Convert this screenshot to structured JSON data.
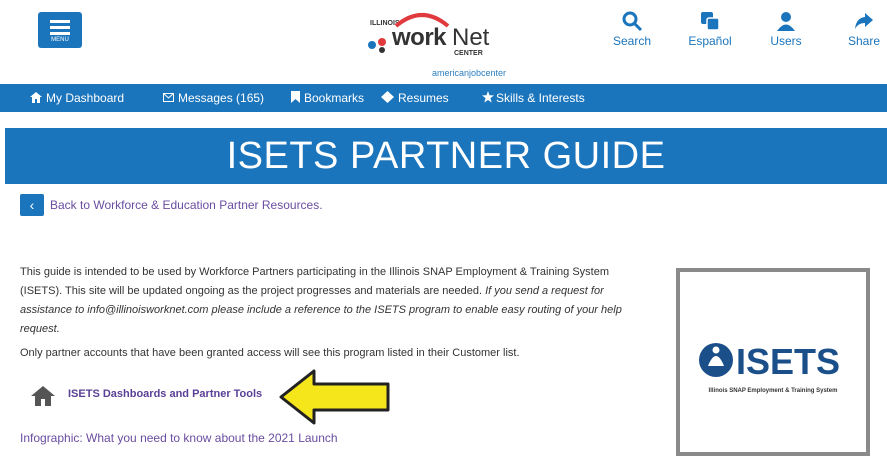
{
  "header": {
    "menu_label": "MENU",
    "logo": {
      "illinois": "ILLINOIS",
      "work": "work",
      "net": "Net",
      "center": "CENTER",
      "ajc": "americanjobcenter"
    },
    "actions": [
      {
        "label": "Search",
        "icon": "search-icon"
      },
      {
        "label": "Español",
        "icon": "translate-icon"
      },
      {
        "label": "Users",
        "icon": "user-icon"
      },
      {
        "label": "Share",
        "icon": "share-icon"
      }
    ]
  },
  "nav": {
    "items": [
      {
        "label": "My Dashboard",
        "icon": "home-icon"
      },
      {
        "label": "Messages (165)",
        "icon": "envelope-icon"
      },
      {
        "label": "Bookmarks",
        "icon": "bookmark-icon"
      },
      {
        "label": "Resumes",
        "icon": "resume-icon"
      },
      {
        "label": "Skills & Interests",
        "icon": "star-icon"
      }
    ]
  },
  "banner": {
    "title": "ISETS PARTNER GUIDE"
  },
  "back": {
    "label": "Back to Workforce & Education Partner Resources."
  },
  "content": {
    "intro_plain": "This guide is intended to be used by Workforce Partners participating in the Illinois SNAP Employment & Training System (ISETS). This site will be updated ongoing as the project progresses and materials are needed.",
    "intro_italic": "If you send a request for assistance to info@illinoisworknet.com please include a reference to the ISETS program to enable easy routing of your help request.",
    "access_note": "Only partner accounts that have been granted access will see this program listed in their Customer list.",
    "dashboard_link": "ISETS Dashboards and Partner Tools",
    "infographic_link": "Infographic:  What you need to know about the 2021 Launch"
  },
  "isets_logo": {
    "wordmark": "ISETS",
    "subtitle": "Illinois SNAP Employment & Training System"
  },
  "colors": {
    "brand_blue": "#1b75bc",
    "link_purple": "#6a4da0",
    "arrow_yellow": "#f5e61b"
  }
}
